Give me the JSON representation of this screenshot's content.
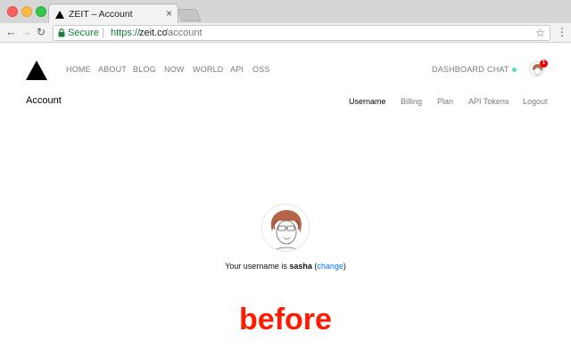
{
  "browser": {
    "tab_title": "ZEIT – Account",
    "tab_close": "×",
    "secure_label": "Secure",
    "url_scheme": "https://",
    "url_host": "zeit.co",
    "url_path": "/account",
    "nav_icons": [
      "back-arrow-icon",
      "forward-arrow-icon",
      "reload-icon"
    ],
    "menu_icon": "⋮",
    "star_icon": "☆"
  },
  "nav": {
    "home": "HOME",
    "about": "ABOUT",
    "blog": "BLOG",
    "now": "NOW",
    "world": "WORLD",
    "api": "API",
    "oss": "OSS",
    "dashboard": "DASHBOARD",
    "chat": "CHAT",
    "notification_count": "1"
  },
  "account": {
    "title": "Account",
    "tabs": {
      "username": "Username",
      "billing": "Billing",
      "plan": "Plan",
      "api_tokens": "API Tokens",
      "logout": "Logout"
    },
    "username_prefix": "Your username is ",
    "username": "sasha",
    "change_open": " (",
    "change_label": "change",
    "change_close": ")"
  },
  "overlay_label": "before",
  "colors": {
    "accent_link": "#0076ff",
    "secure_green": "#188038",
    "chat_online": "#50e3c2",
    "badge_red": "#ee0000",
    "overlay_red": "#ff1a00"
  }
}
